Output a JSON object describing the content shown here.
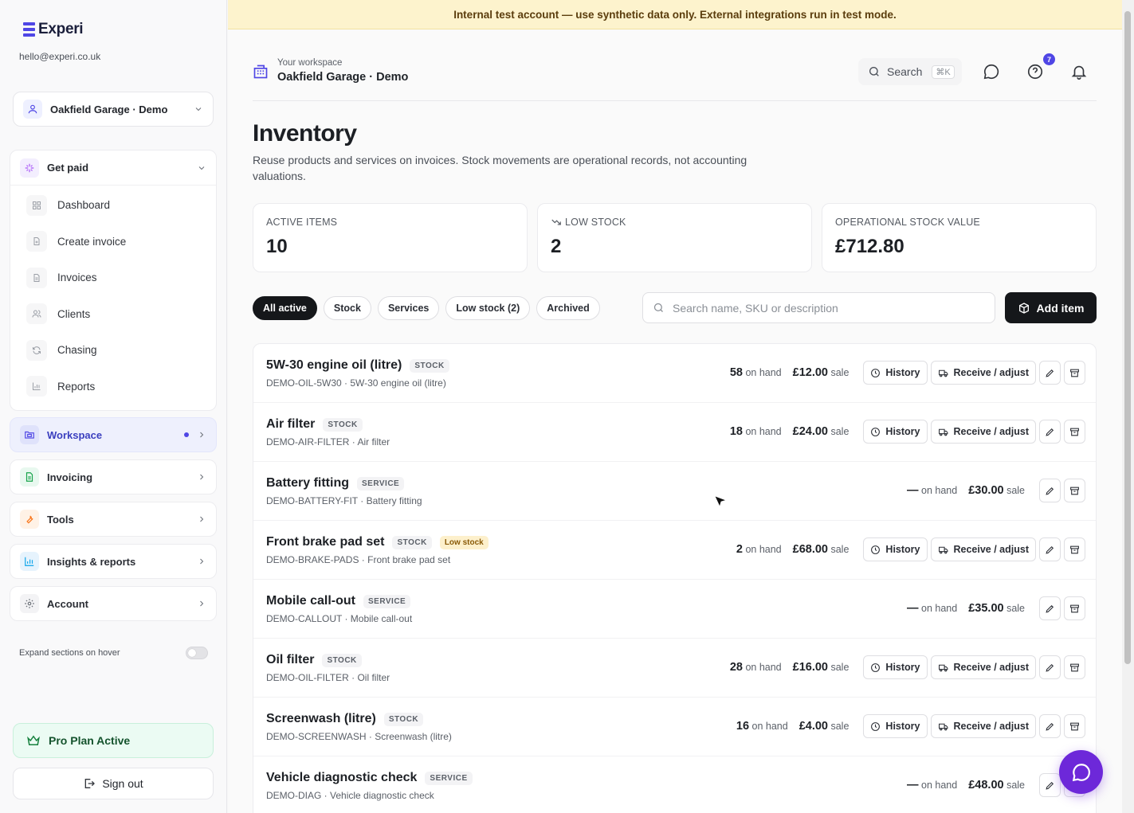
{
  "banner": {
    "text": "Internal test account — use synthetic data only. External integrations run in test mode."
  },
  "sidebar": {
    "brand": "Experi",
    "email": "hello@experi.co.uk",
    "workspace_selector": "Oakfield Garage · Demo",
    "get_paid": {
      "label": "Get paid",
      "items": [
        {
          "label": "Dashboard",
          "icon": "grid-icon"
        },
        {
          "label": "Create invoice",
          "icon": "file-plus-icon"
        },
        {
          "label": "Invoices",
          "icon": "file-text-icon"
        },
        {
          "label": "Clients",
          "icon": "users-icon"
        },
        {
          "label": "Chasing",
          "icon": "refresh-icon"
        },
        {
          "label": "Reports",
          "icon": "bar-chart-icon"
        }
      ]
    },
    "groups": [
      {
        "label": "Workspace",
        "icon": "folder-icon",
        "active": true
      },
      {
        "label": "Invoicing",
        "icon": "document-icon",
        "active": false
      },
      {
        "label": "Tools",
        "icon": "wrench-icon",
        "active": false
      },
      {
        "label": "Insights & reports",
        "icon": "chart-icon",
        "active": false
      },
      {
        "label": "Account",
        "icon": "gear-icon",
        "active": false
      }
    ],
    "hover_toggle_label": "Expand sections on hover",
    "pro_plan": "Pro Plan Active",
    "sign_out": "Sign out"
  },
  "header": {
    "caption": "Your workspace",
    "workspace_name": "Oakfield Garage · Demo",
    "search_label": "Search",
    "search_shortcut": "⌘K",
    "help_badge": "7"
  },
  "page": {
    "title": "Inventory",
    "description": "Reuse products and services on invoices. Stock movements are operational records, not accounting valuations."
  },
  "stats": [
    {
      "label": "ACTIVE ITEMS",
      "value": "10"
    },
    {
      "label": "LOW STOCK",
      "value": "2"
    },
    {
      "label": "OPERATIONAL STOCK VALUE",
      "value": "£712.80"
    }
  ],
  "filters": [
    "All active",
    "Stock",
    "Services",
    "Low stock (2)",
    "Archived"
  ],
  "active_filter": "All active",
  "inventory_search": {
    "placeholder": "Search name, SKU or description"
  },
  "add_item": "Add item",
  "labels": {
    "on_hand": "on hand",
    "sale": "sale",
    "history": "History",
    "receive": "Receive / adjust",
    "low_stock": "Low stock"
  },
  "items": [
    {
      "name": "5W-30 engine oil (litre)",
      "type": "STOCK",
      "sku": "DEMO-OIL-5W30 · 5W-30 engine oil (litre)",
      "on_hand": "58",
      "price": "£12.00",
      "low": false
    },
    {
      "name": "Air filter",
      "type": "STOCK",
      "sku": "DEMO-AIR-FILTER · Air filter",
      "on_hand": "18",
      "price": "£24.00",
      "low": false
    },
    {
      "name": "Battery fitting",
      "type": "SERVICE",
      "sku": "DEMO-BATTERY-FIT · Battery fitting",
      "on_hand": "—",
      "price": "£30.00",
      "low": false
    },
    {
      "name": "Front brake pad set",
      "type": "STOCK",
      "sku": "DEMO-BRAKE-PADS · Front brake pad set",
      "on_hand": "2",
      "price": "£68.00",
      "low": true
    },
    {
      "name": "Mobile call-out",
      "type": "SERVICE",
      "sku": "DEMO-CALLOUT · Mobile call-out",
      "on_hand": "—",
      "price": "£35.00",
      "low": false
    },
    {
      "name": "Oil filter",
      "type": "STOCK",
      "sku": "DEMO-OIL-FILTER · Oil filter",
      "on_hand": "28",
      "price": "£16.00",
      "low": false
    },
    {
      "name": "Screenwash (litre)",
      "type": "STOCK",
      "sku": "DEMO-SCREENWASH · Screenwash (litre)",
      "on_hand": "16",
      "price": "£4.00",
      "low": false
    },
    {
      "name": "Vehicle diagnostic check",
      "type": "SERVICE",
      "sku": "DEMO-DIAG · Vehicle diagnostic check",
      "on_hand": "—",
      "price": "£48.00",
      "low": false
    }
  ]
}
